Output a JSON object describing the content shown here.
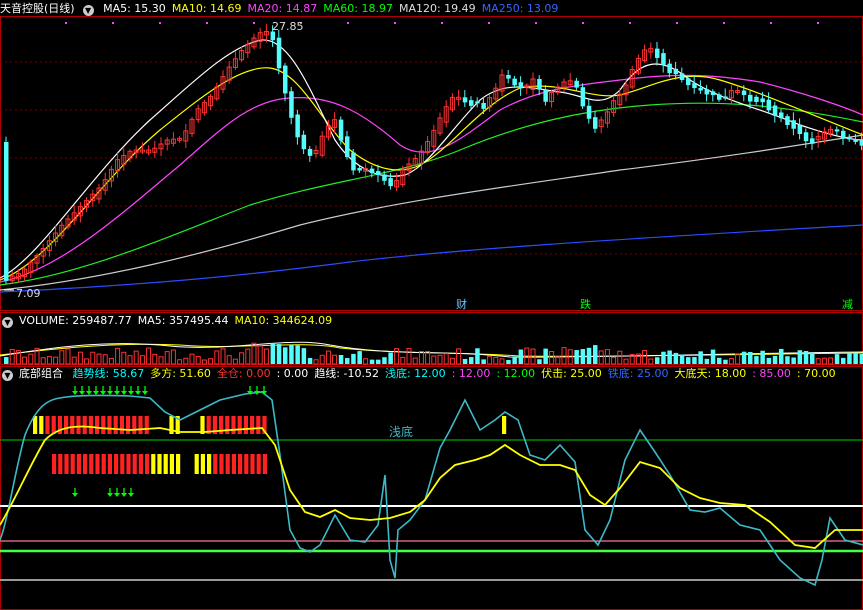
{
  "main_panel": {
    "title": "天音控股(日线)",
    "indicators": [
      {
        "text": "MA5: 15.30",
        "color": "#ffffff"
      },
      {
        "text": "MA10: 14.69",
        "color": "#ffff00"
      },
      {
        "text": "MA20: 14.87",
        "color": "#ff44ff"
      },
      {
        "text": "MA60: 18.97",
        "color": "#00ff00"
      },
      {
        "text": "MA120: 19.49",
        "color": "#dddddd"
      },
      {
        "text": "MA250: 13.09",
        "color": "#3366ff"
      }
    ],
    "high_label": "27.85",
    "low_label": "7.09",
    "events": [
      {
        "text": "财",
        "color": "#6fc3ff"
      },
      {
        "text": "跌",
        "color": "#00ff00"
      },
      {
        "text": "减",
        "color": "#00ff00"
      }
    ]
  },
  "volume_panel": {
    "indicators": [
      {
        "text": "VOLUME: 259487.77",
        "color": "#ffffff"
      },
      {
        "text": "MA5: 357495.44",
        "color": "#ffffff"
      },
      {
        "text": "MA10: 344624.09",
        "color": "#ffff00"
      }
    ]
  },
  "indicator_panel": {
    "name": "底部组合",
    "indicators": [
      {
        "text": "趋势线: 58.67",
        "color": "#00ffff"
      },
      {
        "text": "多方: 51.60",
        "color": "#ffff00"
      },
      {
        "text": "全仓: 0.00",
        "color": "#ff3333"
      },
      {
        "text": ": 0.00",
        "color": "#ffffff"
      },
      {
        "text": "趋线: -10.52",
        "color": "#ffffff"
      },
      {
        "text": "浅底: 12.00",
        "color": "#00ffff"
      },
      {
        "text": ": 12.00",
        "color": "#ff44ff"
      },
      {
        "text": ": 12.00",
        "color": "#00ff00"
      },
      {
        "text": "伏击: 25.00",
        "color": "#ffff00"
      },
      {
        "text": "铁底: 25.00",
        "color": "#3366ff"
      },
      {
        "text": "大底天: 18.00",
        "color": "#ffff00"
      },
      {
        "text": ": 85.00",
        "color": "#ff44ff"
      },
      {
        "text": ": 70.00",
        "color": "#ffff00"
      }
    ],
    "annotation": "浅底"
  },
  "colors": {
    "up": "#ff3232",
    "down": "#54fcfc",
    "frame": "#b00000",
    "grid": "#800000"
  }
}
